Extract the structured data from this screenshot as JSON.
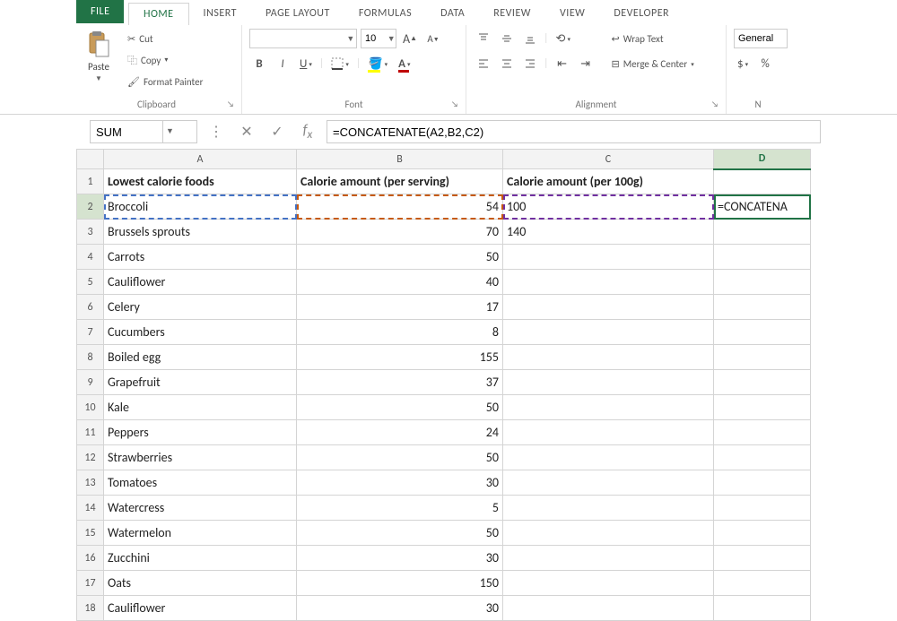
{
  "tabs": {
    "file": "FILE",
    "home": "HOME",
    "insert": "INSERT",
    "page_layout": "PAGE LAYOUT",
    "formulas": "FORMULAS",
    "data": "DATA",
    "review": "REVIEW",
    "view": "VIEW",
    "developer": "DEVELOPER"
  },
  "ribbon": {
    "clipboard": {
      "label": "Clipboard",
      "paste": "Paste",
      "cut": "Cut",
      "copy": "Copy",
      "format_painter": "Format Painter"
    },
    "font": {
      "label": "Font",
      "font_name": "",
      "font_size": "10"
    },
    "alignment": {
      "label": "Alignment",
      "wrap_text": "Wrap Text",
      "merge_center": "Merge & Center"
    },
    "number": {
      "label_short": "N",
      "format": "General"
    }
  },
  "formula_bar": {
    "name_box": "SUM",
    "formula": "=CONCATENATE(A2,B2,C2)"
  },
  "columns": [
    "A",
    "B",
    "C",
    "D"
  ],
  "headers": {
    "A": "Lowest calorie foods",
    "B": "Calorie amount (per serving)",
    "C": "Calorie amount (per 100g)",
    "D": ""
  },
  "rows": [
    {
      "n": 1
    },
    {
      "n": 2,
      "A": "Broccoli",
      "B": "54",
      "C": "100",
      "D": "=CONCATENA"
    },
    {
      "n": 3,
      "A": "Brussels sprouts",
      "B": "70",
      "C": "140"
    },
    {
      "n": 4,
      "A": "Carrots",
      "B": "50"
    },
    {
      "n": 5,
      "A": "Cauliflower",
      "B": "40"
    },
    {
      "n": 6,
      "A": "Celery",
      "B": "17"
    },
    {
      "n": 7,
      "A": "Cucumbers",
      "B": "8"
    },
    {
      "n": 8,
      "A": "Boiled egg",
      "B": "155"
    },
    {
      "n": 9,
      "A": "Grapefruit",
      "B": "37"
    },
    {
      "n": 10,
      "A": "Kale",
      "B": "50"
    },
    {
      "n": 11,
      "A": "Peppers",
      "B": "24"
    },
    {
      "n": 12,
      "A": "Strawberries",
      "B": "50"
    },
    {
      "n": 13,
      "A": "Tomatoes",
      "B": "30"
    },
    {
      "n": 14,
      "A": "Watercress",
      "B": "5"
    },
    {
      "n": 15,
      "A": "Watermelon",
      "B": "50"
    },
    {
      "n": 16,
      "A": "Zucchini",
      "B": "30"
    },
    {
      "n": 17,
      "A": "Oats",
      "B": "150"
    },
    {
      "n": 18,
      "A": "Cauliflower",
      "B": "30"
    }
  ]
}
